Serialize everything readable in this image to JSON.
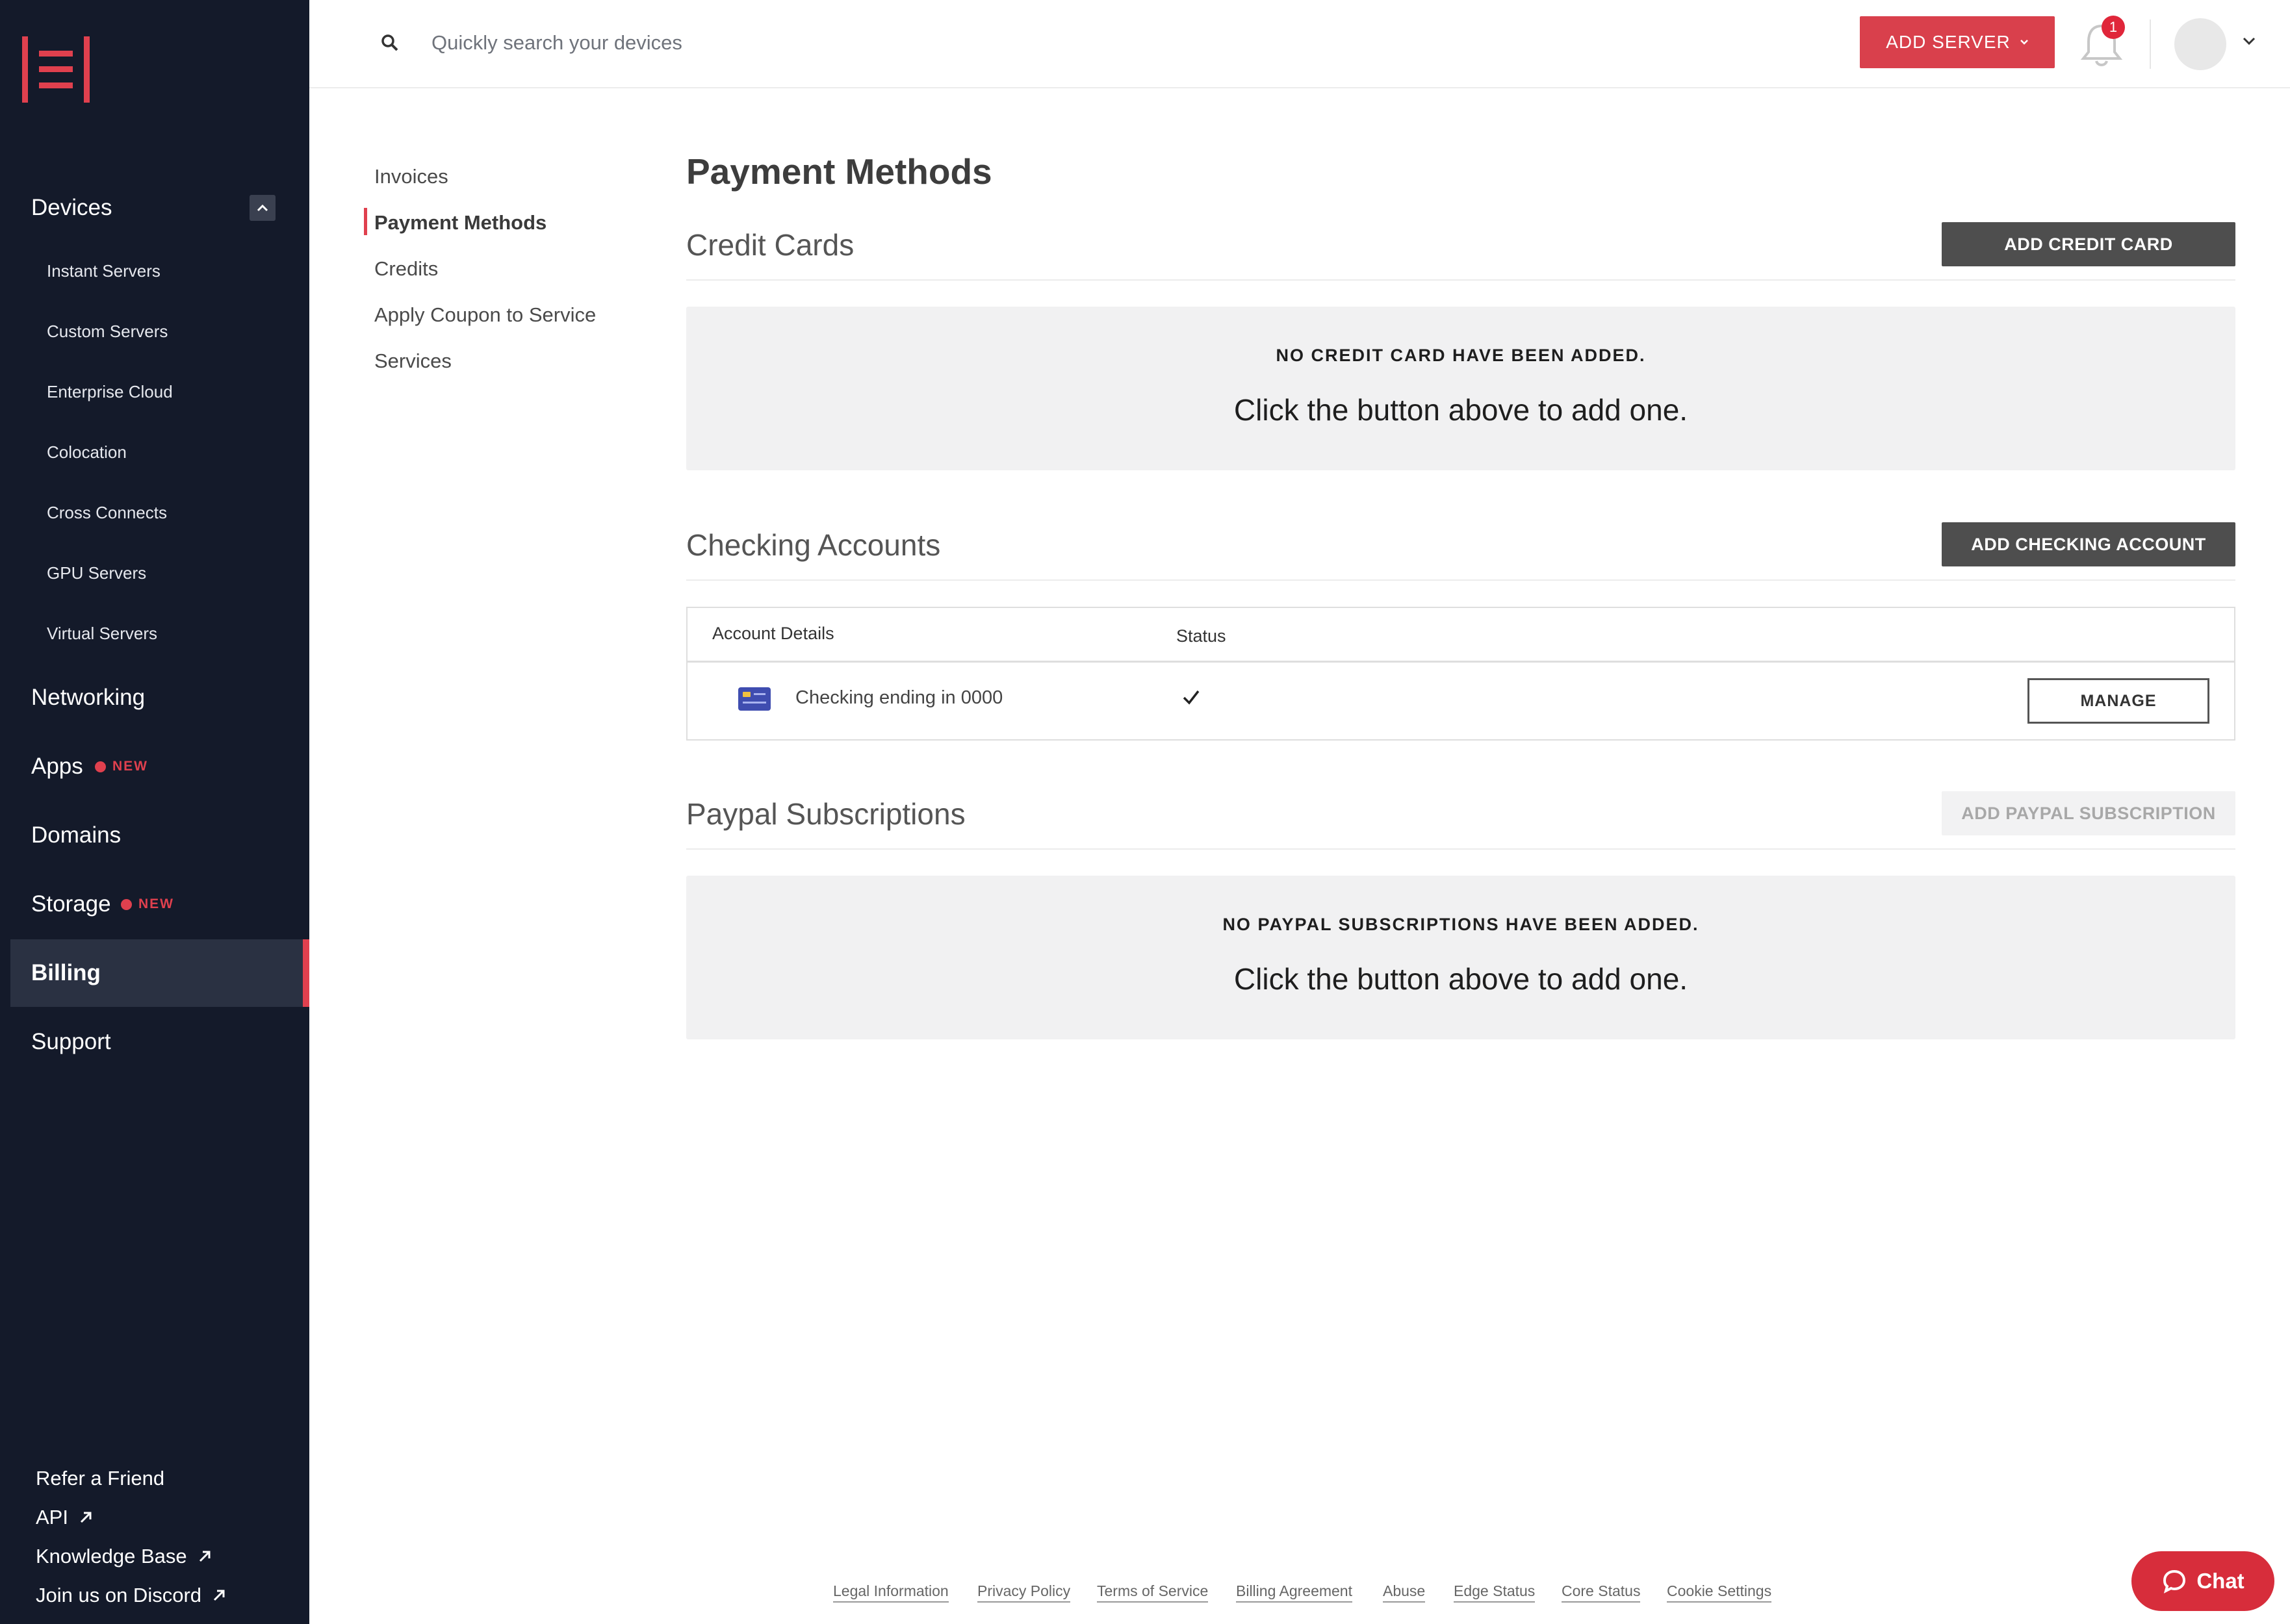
{
  "sidebar": {
    "logo": "phoenixnap-logo",
    "devices_label": "Devices",
    "devices_sub": [
      "Instant Servers",
      "Custom Servers",
      "Enterprise Cloud",
      "Colocation",
      "Cross Connects",
      "GPU Servers",
      "Virtual Servers"
    ],
    "networking": "Networking",
    "apps": "Apps",
    "domains": "Domains",
    "storage": "Storage",
    "billing": "Billing",
    "support": "Support",
    "new_badge": "NEW",
    "footer": {
      "refer": "Refer a Friend",
      "api": "API",
      "kb": "Knowledge Base",
      "discord": "Join us on Discord"
    }
  },
  "topbar": {
    "search_placeholder": "Quickly search your devices",
    "add_server": "ADD SERVER",
    "notifications_count": "1"
  },
  "subnav": {
    "items": [
      "Invoices",
      "Payment Methods",
      "Credits",
      "Apply Coupon to Service",
      "Services"
    ],
    "active": "Payment Methods"
  },
  "main": {
    "title": "Payment Methods",
    "credit_cards": {
      "title": "Credit Cards",
      "button": "ADD CREDIT CARD",
      "empty_title": "NO CREDIT CARD HAVE BEEN ADDED.",
      "empty_text": "Click the button above to add one."
    },
    "checking": {
      "title": "Checking Accounts",
      "button": "ADD CHECKING ACCOUNT",
      "col_details": "Account Details",
      "col_status": "Status",
      "row_label": "Checking ending in 0000",
      "manage": "MANAGE"
    },
    "paypal": {
      "title": "Paypal Subscriptions",
      "button": "ADD PAYPAL SUBSCRIPTION",
      "empty_title": "NO PAYPAL SUBSCRIPTIONS HAVE BEEN ADDED.",
      "empty_text": "Click the button above to add one."
    }
  },
  "footer": {
    "links": [
      "Legal Information",
      "Privacy Policy",
      "Terms of Service",
      "Billing Agreement",
      "Abuse",
      "Edge Status",
      "Core Status",
      "Cookie Settings"
    ],
    "chat": "Chat"
  },
  "colors": {
    "sidebar_bg": "#141a2a",
    "accent": "#d9404c",
    "dark_button": "#4e4e4e"
  }
}
